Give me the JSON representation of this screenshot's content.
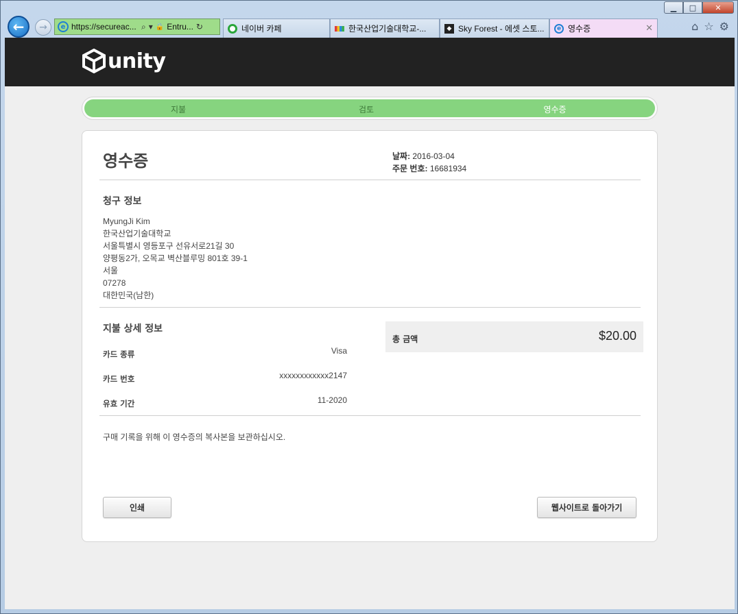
{
  "browser": {
    "window_buttons": {
      "minimize": "▁",
      "maximize": "□",
      "close": "✕"
    },
    "back_icon": "arrow-left-icon",
    "forward_icon": "arrow-right-icon",
    "address": {
      "url": "https://secureac...",
      "search_glyph": "⌕",
      "dropdown_glyph": "▾",
      "lock_glyph": "🔒",
      "cert_label": "Entru...",
      "refresh_glyph": "↻"
    },
    "tabs": [
      {
        "label": "네이버 카페",
        "icon": "naver-cafe-icon"
      },
      {
        "label": "한국산업기술대학교-...",
        "icon": "university-icon"
      },
      {
        "label": "Sky Forest - 에셋 스토...",
        "icon": "unity-icon"
      },
      {
        "label": "영수증",
        "icon": "ie-icon",
        "active": true
      }
    ],
    "tab_close_glyph": "✕",
    "toolbar_icons": {
      "home": "⌂",
      "favorites": "☆",
      "settings": "⚙"
    }
  },
  "site": {
    "logo_text": "unity",
    "steps": [
      {
        "label": "지불"
      },
      {
        "label": "검토"
      },
      {
        "label": "영수증",
        "current": true
      }
    ]
  },
  "receipt": {
    "title": "영수증",
    "date_label": "날짜:",
    "date_value": "2016-03-04",
    "order_label": "주문 번호:",
    "order_value": "16681934",
    "billing": {
      "title": "청구 정보",
      "lines": [
        "MyungJi Kim",
        "한국산업기술대학교",
        "서울특별시 영등포구 선유서로21길 30",
        "양평동2가, 오목교 벽산블루밍 801호 39-1",
        "서울",
        "07278",
        "대한민국(남한)"
      ]
    },
    "payment": {
      "title": "지불 상세 정보",
      "rows": [
        {
          "label": "카드 종류",
          "value": "Visa"
        },
        {
          "label": "카드 번호",
          "value": "xxxxxxxxxxxx2147"
        },
        {
          "label": "유효 기간",
          "value": "11-2020"
        }
      ]
    },
    "total": {
      "label": "총 금액",
      "value": "$20.00"
    },
    "note": "구매 기록을 위해 이 영수증의 복사본을 보관하십시오.",
    "buttons": {
      "print": "인쇄",
      "back_to_site": "웹사이트로 돌아가기"
    }
  },
  "colors": {
    "header_bg": "#222222",
    "progress_green": "#86d47f",
    "address_bar_green": "#9fdc8a",
    "active_tab": "#f4dcf6"
  }
}
